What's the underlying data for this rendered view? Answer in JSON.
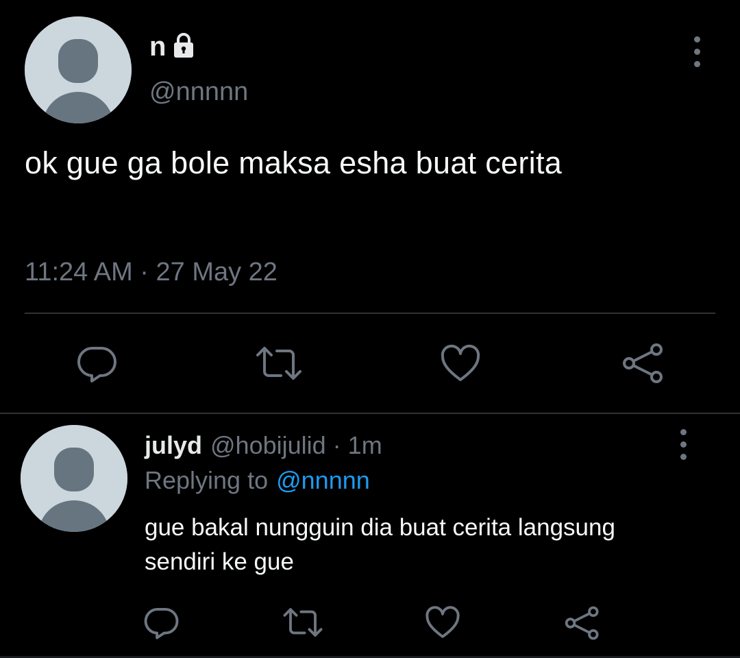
{
  "main_tweet": {
    "display_name": "n",
    "handle": "@nnnnn",
    "text": "ok gue ga bole maksa esha buat cerita",
    "timestamp": "11:24 AM · 27 May 22",
    "icons": {
      "lock": "lock-icon",
      "more": "more-vertical-icon",
      "reply": "reply-icon",
      "retweet": "retweet-icon",
      "like": "heart-icon",
      "share": "share-icon"
    }
  },
  "reply": {
    "display_name": "julyd",
    "handle": "@hobijulid",
    "separator": "·",
    "time": "1m",
    "replying_to_label": "Replying to",
    "replying_to_handle": "@nnnnn",
    "text": "gue bakal nungguin dia buat cerita langsung sendiri ke gue"
  },
  "colors": {
    "background": "#000000",
    "text": "#e7e9ea",
    "muted": "#6e7681",
    "link": "#1d9bf0",
    "avatar_bg": "#ccd6dd",
    "avatar_fg": "#66757f"
  }
}
